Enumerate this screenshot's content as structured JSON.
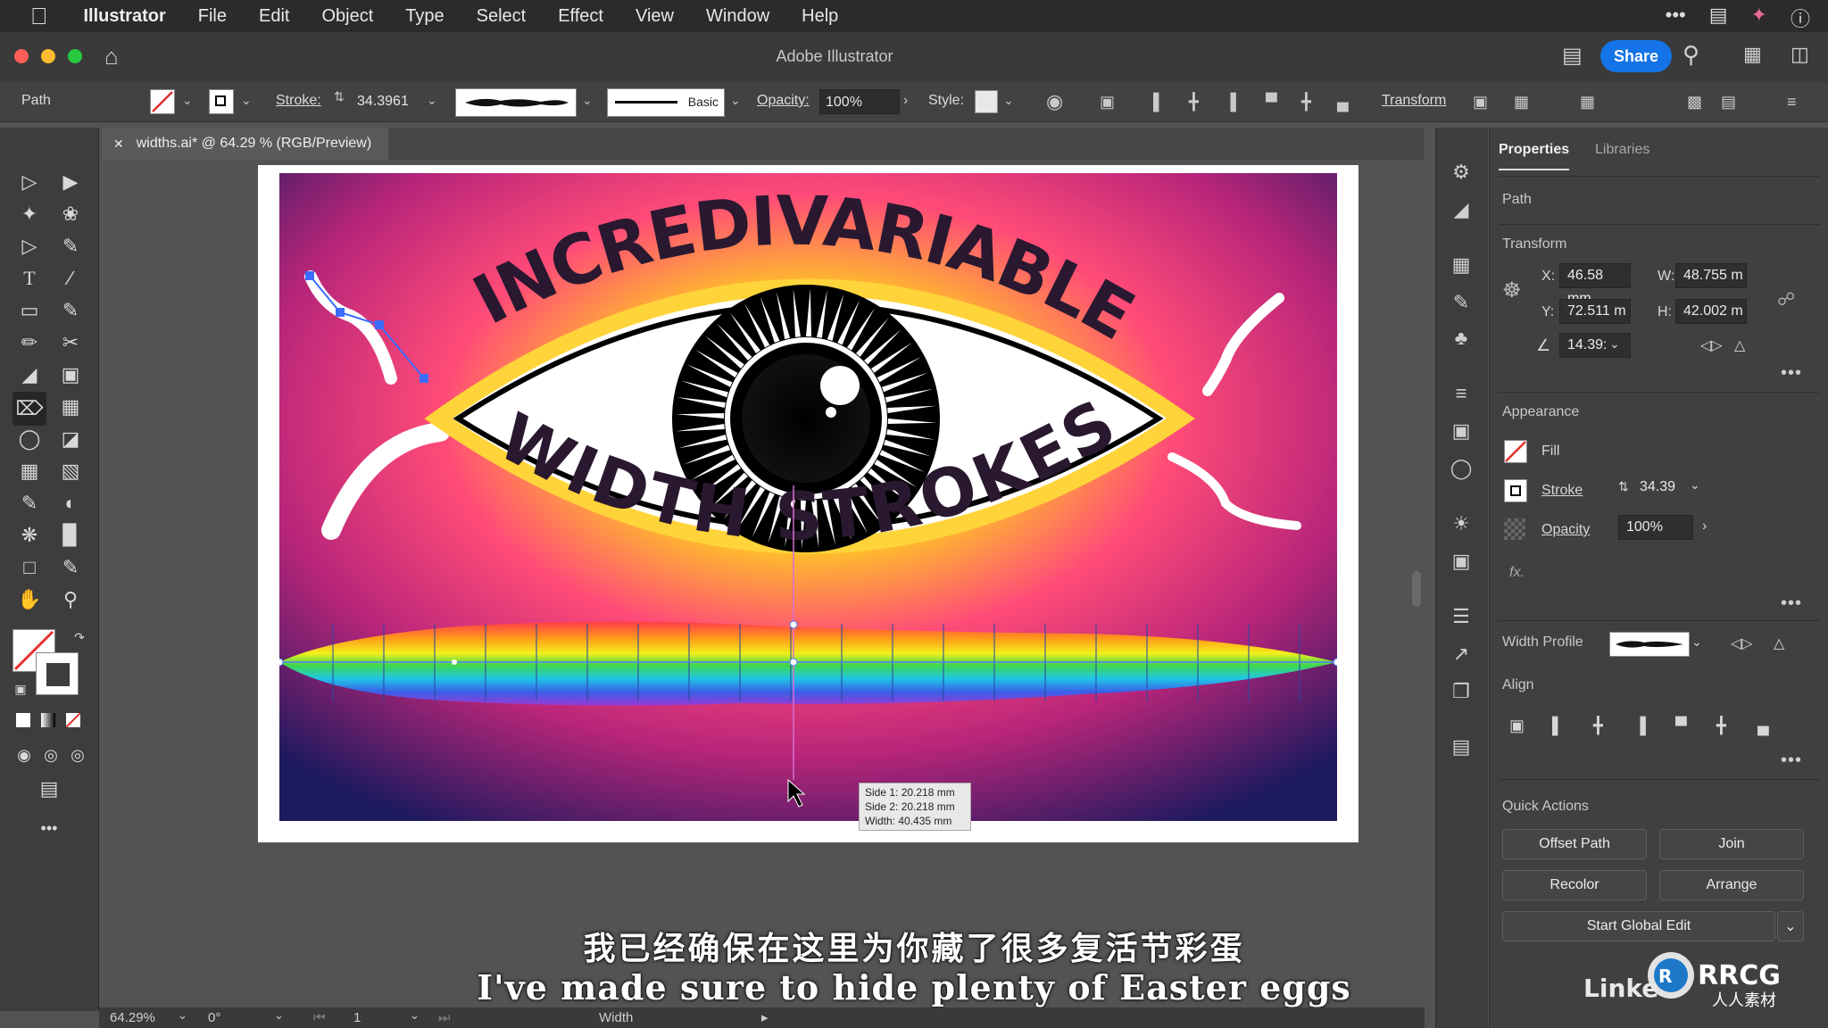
{
  "menubar": {
    "app_name": "Illustrator",
    "items": [
      "File",
      "Edit",
      "Object",
      "Type",
      "Select",
      "Effect",
      "View",
      "Window",
      "Help"
    ]
  },
  "titlebar": {
    "title": "Adobe Illustrator",
    "share_label": "Share"
  },
  "controlbar": {
    "selection_type": "Path",
    "stroke_label": "Stroke:",
    "stroke_value": "34.3961",
    "brush_label": "Basic",
    "opacity_label": "Opacity:",
    "opacity_value": "100%",
    "style_label": "Style:",
    "transform_label": "Transform"
  },
  "document": {
    "tab_title": "widths.ai* @ 64.29 % (RGB/Preview)"
  },
  "artwork": {
    "headline_top": "INCREDIVARIABLE",
    "headline_bottom": "WIDTH STROKES"
  },
  "width_tooltip": {
    "side1": "Side 1: 20.218 mm",
    "side2": "Side 2: 20.218 mm",
    "width": "Width: 40.435 mm"
  },
  "statusbar": {
    "zoom": "64.29%",
    "rotation": "0°",
    "artboard": "1",
    "tool_name": "Width"
  },
  "panel": {
    "tabs": [
      "Properties",
      "Libraries"
    ],
    "object_type": "Path",
    "transform": {
      "header": "Transform",
      "x_label": "X:",
      "x_value": "46.58 mm",
      "y_label": "Y:",
      "y_value": "72.511 m",
      "w_label": "W:",
      "w_value": "48.755 m",
      "h_label": "H:",
      "h_value": "42.002 m",
      "angle_value": "14.39:"
    },
    "appearance": {
      "header": "Appearance",
      "fill_label": "Fill",
      "stroke_label": "Stroke",
      "stroke_value": "34.39",
      "opacity_label": "Opacity",
      "opacity_value": "100%",
      "fx_label": "fx."
    },
    "width_profile_label": "Width Profile",
    "align_header": "Align",
    "quick_actions": {
      "header": "Quick Actions",
      "offset_path": "Offset Path",
      "join": "Join",
      "recolor": "Recolor",
      "arrange": "Arrange",
      "start_global_edit": "Start Global Edit"
    }
  },
  "subtitles": {
    "chinese": "我已经确保在这里为你藏了很多复活节彩蛋",
    "english": "I've made sure to hide plenty of Easter eggs"
  },
  "watermark": {
    "brand": "RRCG",
    "sub": "人人素材",
    "linkedin": "Linke"
  },
  "colors": {
    "accent": "#1473e6",
    "menubar_bg": "#2b2b2b",
    "panel_bg": "#404040",
    "canvas_bg": "#535353"
  }
}
